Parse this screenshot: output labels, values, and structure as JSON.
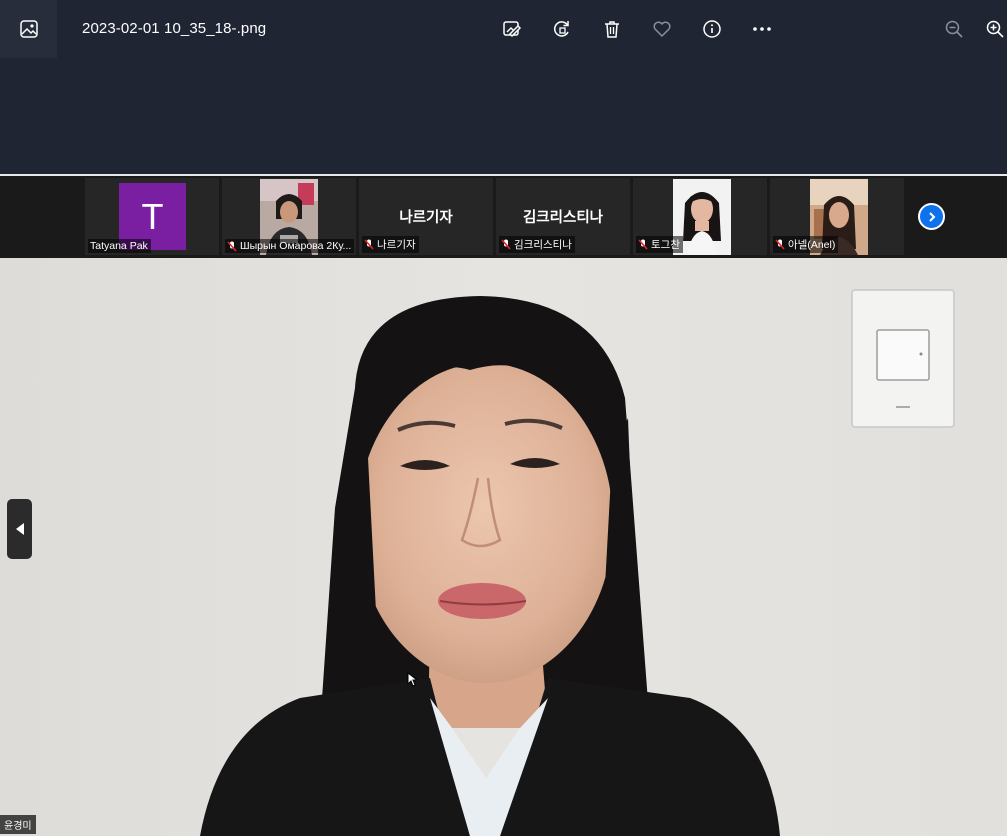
{
  "titlebar": {
    "file_name": "2023-02-01 10_35_18-.png",
    "app_icon": "photo-app-icon",
    "actions": [
      "edit-image-icon",
      "rotate-icon",
      "delete-icon",
      "favorite-icon",
      "info-icon",
      "more-icon"
    ],
    "zoom_actions": [
      "zoom-out-icon",
      "zoom-in-icon"
    ]
  },
  "participants": [
    {
      "name": "Tatyana Pak",
      "avatar_letter": "T",
      "muted": false,
      "avatar_color": "#7b1fa2"
    },
    {
      "name": "Шырын Омарова 2Ку...",
      "muted": true
    },
    {
      "name": "나르기자",
      "display_name": "나르기자",
      "muted": true
    },
    {
      "name": "김크리스티나",
      "display_name": "김크리스티나",
      "muted": true
    },
    {
      "name": "토그찬",
      "muted": true
    },
    {
      "name": "아넬(Anel)",
      "muted": true
    }
  ],
  "speaker": {
    "name": "윤경미"
  },
  "colors": {
    "titlebar_bg": "#1f2533",
    "strip_bg": "#1a1a1a",
    "accent_blue": "#0e72ed",
    "muted_red": "#e02828"
  }
}
